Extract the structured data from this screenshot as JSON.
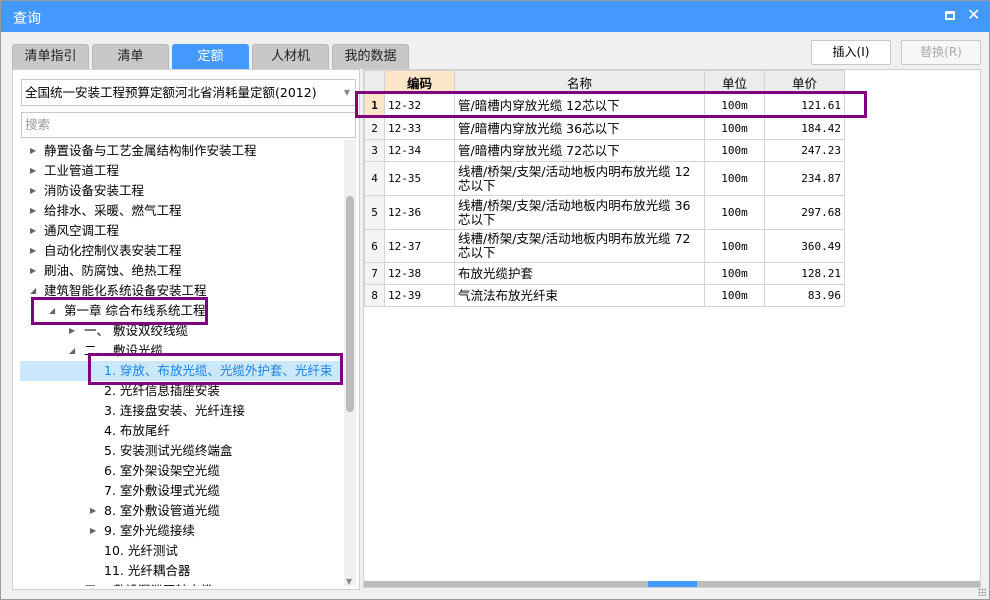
{
  "window": {
    "title": "查询"
  },
  "tabs": [
    {
      "label": "清单指引"
    },
    {
      "label": "清单"
    },
    {
      "label": "定额",
      "active": true
    },
    {
      "label": "人材机"
    },
    {
      "label": "我的数据"
    }
  ],
  "buttons": {
    "insert": "插入(I)",
    "replace": "替换(R)"
  },
  "left": {
    "library": "全国统一安装工程预算定额河北省消耗量定额(2012)",
    "search_placeholder": "搜索",
    "tree": [
      {
        "label": "静置设备与工艺金属结构制作安装工程",
        "level": 0,
        "arrow": "collapsed"
      },
      {
        "label": "工业管道工程",
        "level": 0,
        "arrow": "collapsed"
      },
      {
        "label": "消防设备安装工程",
        "level": 0,
        "arrow": "collapsed"
      },
      {
        "label": "给排水、采暖、燃气工程",
        "level": 0,
        "arrow": "collapsed"
      },
      {
        "label": "通风空调工程",
        "level": 0,
        "arrow": "collapsed"
      },
      {
        "label": "自动化控制仪表安装工程",
        "level": 0,
        "arrow": "collapsed"
      },
      {
        "label": "刷油、防腐蚀、绝热工程",
        "level": 0,
        "arrow": "collapsed"
      },
      {
        "label": "建筑智能化系统设备安装工程",
        "level": 0,
        "arrow": "expanded"
      },
      {
        "label": "第一章 综合布线系统工程",
        "level": 1,
        "arrow": "expanded"
      },
      {
        "label": "一、 敷设双绞线缆",
        "level": 2,
        "arrow": "collapsed"
      },
      {
        "label": "二、 敷设光缆",
        "level": 2,
        "arrow": "expanded"
      },
      {
        "label": "1. 穿放、布放光缆、光缆外护套、光纤束",
        "level": 3,
        "arrow": "none",
        "selected": true
      },
      {
        "label": "2. 光纤信息插座安装",
        "level": 3,
        "arrow": "none"
      },
      {
        "label": "3. 连接盘安装、光纤连接",
        "level": 3,
        "arrow": "none"
      },
      {
        "label": "4. 布放尾纤",
        "level": 3,
        "arrow": "none"
      },
      {
        "label": "5. 安装测试光缆终端盒",
        "level": 3,
        "arrow": "none"
      },
      {
        "label": "6. 室外架设架空光缆",
        "level": 3,
        "arrow": "none"
      },
      {
        "label": "7. 室外敷设埋式光缆",
        "level": 3,
        "arrow": "none"
      },
      {
        "label": "8. 室外敷设管道光缆",
        "level": 3,
        "arrow": "collapsed"
      },
      {
        "label": "9. 室外光缆接续",
        "level": 3,
        "arrow": "collapsed"
      },
      {
        "label": "10. 光纤测试",
        "level": 3,
        "arrow": "none"
      },
      {
        "label": "11. 光纤耦合器",
        "level": 3,
        "arrow": "none"
      },
      {
        "label": "三、 敷设漏泄同轴电缆",
        "level": 2,
        "arrow": "none"
      }
    ]
  },
  "table": {
    "headers": [
      "",
      "编码",
      "名称",
      "单位",
      "单价"
    ],
    "rows": [
      [
        "1",
        "12-32",
        "管/暗槽内穿放光缆 12芯以下",
        "100m",
        "121.61"
      ],
      [
        "2",
        "12-33",
        "管/暗槽内穿放光缆 36芯以下",
        "100m",
        "184.42"
      ],
      [
        "3",
        "12-34",
        "管/暗槽内穿放光缆 72芯以下",
        "100m",
        "247.23"
      ],
      [
        "4",
        "12-35",
        "线槽/桥架/支架/活动地板内明布放光缆 12芯以下",
        "100m",
        "234.87"
      ],
      [
        "5",
        "12-36",
        "线槽/桥架/支架/活动地板内明布放光缆 36芯以下",
        "100m",
        "297.68"
      ],
      [
        "6",
        "12-37",
        "线槽/桥架/支架/活动地板内明布放光缆 72芯以下",
        "100m",
        "360.49"
      ],
      [
        "7",
        "12-38",
        "布放光缆护套",
        "100m",
        "128.21"
      ],
      [
        "8",
        "12-39",
        "气流法布放光纤束",
        "100m",
        "83.96"
      ]
    ]
  },
  "colors": {
    "accent": "#4499ff",
    "highlight": "#800080",
    "selected_bg": "#cce8ff"
  }
}
